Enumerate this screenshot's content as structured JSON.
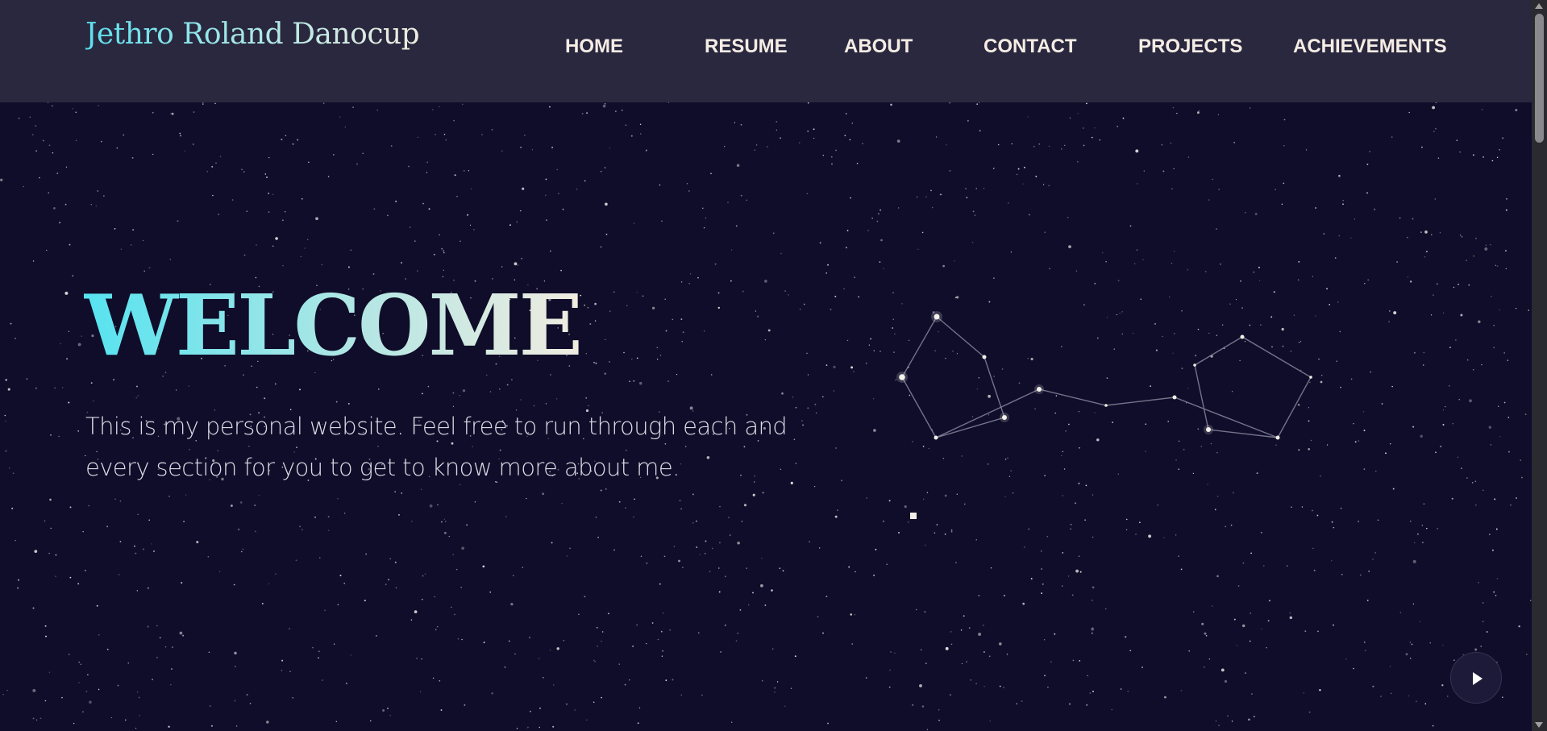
{
  "header": {
    "logo_text": "Jethro Roland Danocup",
    "nav": [
      "HOME",
      "RESUME",
      "ABOUT",
      "CONTACT",
      "PROJECTS",
      "ACHIEVEMENTS"
    ]
  },
  "hero": {
    "title": "WELCOME",
    "intro": "This is my personal website. Feel free to run through each and every section for you to get to know more about me."
  },
  "controls": {
    "play_icon": "play-icon"
  },
  "colors": {
    "background": "#0f0d29",
    "header": "#2a283f",
    "nav_text": "#f5ece4",
    "accent_cyan": "#5ce1ee",
    "accent_cream": "#f1ecdf"
  }
}
